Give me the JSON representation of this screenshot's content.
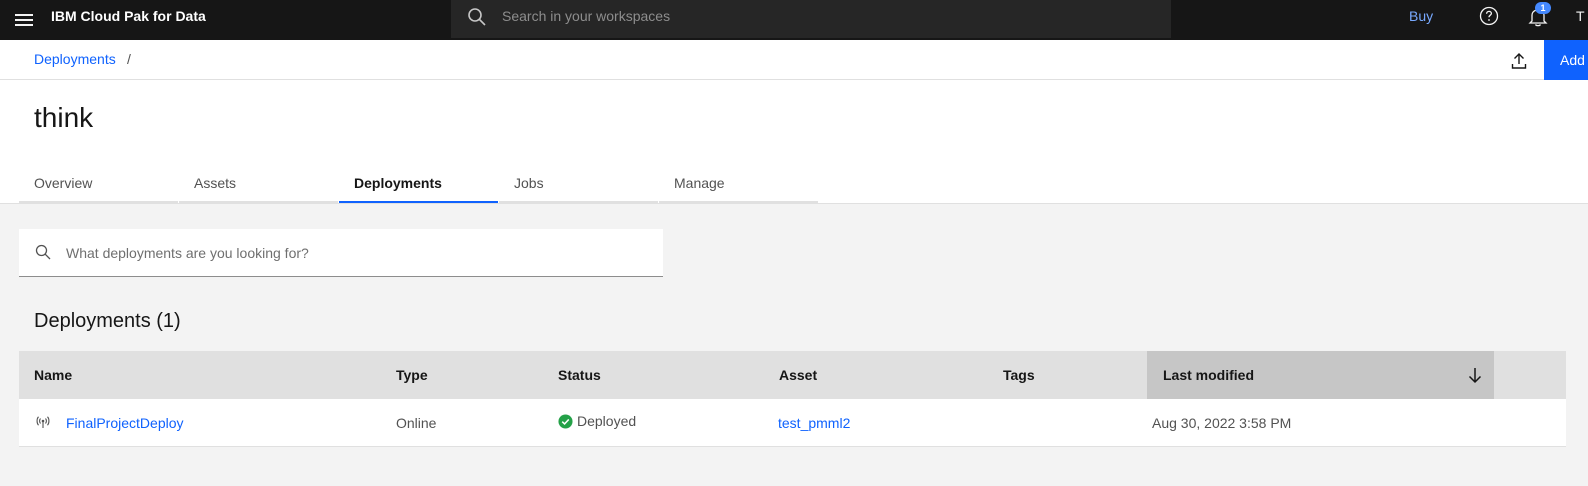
{
  "topbar": {
    "product": "IBM Cloud Pak for Data",
    "search_placeholder": "Search in your workspaces",
    "buy_label": "Buy",
    "notification_count": "1",
    "user_initial": "T"
  },
  "breadcrumb": {
    "items": [
      "Deployments"
    ],
    "separator": "/"
  },
  "actions": {
    "add_label": "Add"
  },
  "page": {
    "title": "think"
  },
  "tabs": [
    {
      "label": "Overview",
      "active": false
    },
    {
      "label": "Assets",
      "active": false
    },
    {
      "label": "Deployments",
      "active": true
    },
    {
      "label": "Jobs",
      "active": false
    },
    {
      "label": "Manage",
      "active": false
    }
  ],
  "search": {
    "placeholder": "What deployments are you looking for?"
  },
  "section": {
    "title": "Deployments (1)"
  },
  "table": {
    "columns": [
      "Name",
      "Type",
      "Status",
      "Asset",
      "Tags",
      "Last modified"
    ],
    "sorted_column": "Last modified",
    "sort_direction": "descending",
    "rows": [
      {
        "name": "FinalProjectDeploy",
        "type": "Online",
        "status": "Deployed",
        "asset": "test_pmml2",
        "tags": "",
        "last_modified": "Aug 30, 2022 3:58 PM"
      }
    ]
  },
  "colors": {
    "topbar_bg": "#161616",
    "accent_blue": "#0f62fe",
    "status_green": "#24a148",
    "page_bg": "#f3f3f3"
  }
}
